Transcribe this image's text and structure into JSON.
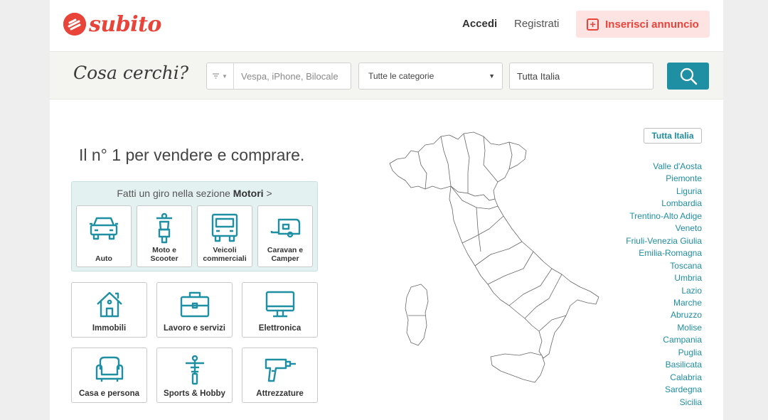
{
  "header": {
    "logo_text": "subito",
    "login_label": "Accedi",
    "register_label": "Registrati",
    "post_ad_label": "Inserisci annuncio"
  },
  "search": {
    "title": "Cosa cerchi?",
    "query_placeholder": "Vespa, iPhone, Bilocale",
    "category_value": "Tutte le categorie",
    "location_value": "Tutta Italia"
  },
  "main": {
    "tagline": "Il n° 1 per vendere e comprare.",
    "motori_prefix": "Fatti un giro nella sezione ",
    "motori_name": "Motori",
    "motori_suffix": " >",
    "motori_categories": [
      {
        "label_line1": "Auto",
        "label_line2": "",
        "icon": "car-icon"
      },
      {
        "label_line1": "Moto e",
        "label_line2": "Scooter",
        "icon": "scooter-icon"
      },
      {
        "label_line1": "Veicoli",
        "label_line2": "commerciali",
        "icon": "van-icon"
      },
      {
        "label_line1": "Caravan e",
        "label_line2": "Camper",
        "icon": "caravan-icon"
      }
    ],
    "categories": [
      {
        "label": "Immobili",
        "icon": "house-icon"
      },
      {
        "label": "Lavoro e servizi",
        "icon": "briefcase-icon"
      },
      {
        "label": "Elettronica",
        "icon": "monitor-icon"
      },
      {
        "label": "Casa e persona",
        "icon": "armchair-icon"
      },
      {
        "label": "Sports & Hobby",
        "icon": "bicycle-icon"
      },
      {
        "label": "Attrezzature",
        "icon": "drill-icon"
      }
    ]
  },
  "map": {
    "all_italy_label": "Tutta Italia",
    "regions": [
      "Valle d'Aosta",
      "Piemonte",
      "Liguria",
      "Lombardia",
      "Trentino-Alto Adige",
      "Veneto",
      "Friuli-Venezia Giulia",
      "Emilia-Romagna",
      "Toscana",
      "Umbria",
      "Lazio",
      "Marche",
      "Abruzzo",
      "Molise",
      "Campania",
      "Puglia",
      "Basilicata",
      "Calabria",
      "Sardegna",
      "Sicilia"
    ]
  },
  "colors": {
    "brand_red": "#e8443a",
    "accent_teal": "#1f8fa3",
    "motori_bg": "#e4f1f1"
  }
}
